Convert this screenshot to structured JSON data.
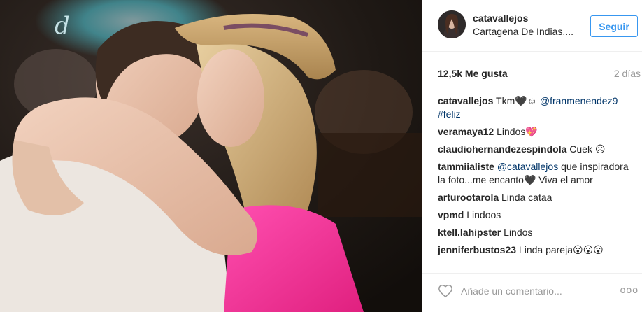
{
  "post": {
    "author": {
      "username": "catavallejos",
      "location": "Cartagena De Indias,..."
    },
    "follow_label": "Seguir",
    "likes": "12,5k Me gusta",
    "timestamp": "2 días",
    "photo_sign_text": "d",
    "comments": [
      {
        "author": "catavallejos",
        "text": "Tkm🖤☺ ",
        "mention": "@franmenendez9",
        "hashtag": "#feliz"
      },
      {
        "author": "veramaya12",
        "text": "Lindos💖"
      },
      {
        "author": "claudiohernandezespindola",
        "text": "Cuek ☹"
      },
      {
        "author": "tammiialiste",
        "mention": "@catavallejos",
        "text": " que inspiradora la foto...me encanto🖤 Viva el amor"
      },
      {
        "author": "arturootarola",
        "text": "Linda cataa"
      },
      {
        "author": "vpmd",
        "text": "Lindoos"
      },
      {
        "author": "ktell.lahipster",
        "text": "Lindos"
      },
      {
        "author": "jenniferbustos23",
        "text": "Linda pareja😮😮😮"
      }
    ],
    "comment_placeholder": "Añade un comentario...",
    "more_label": "ooo"
  },
  "colors": {
    "accent": "#3897f0",
    "link": "#003569",
    "muted": "#999999",
    "divider": "#efefef"
  },
  "icons": {
    "like": "heart-outline-icon",
    "more": "more-options-icon"
  }
}
